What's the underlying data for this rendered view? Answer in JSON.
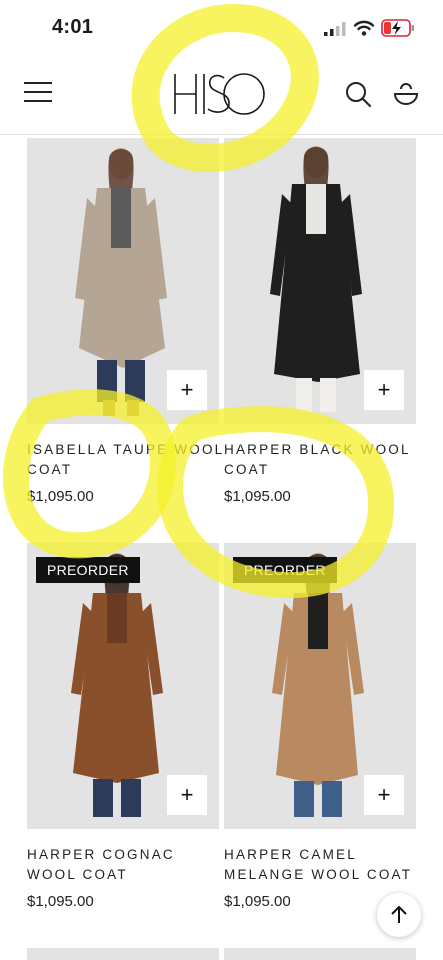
{
  "status_bar": {
    "time": "4:01"
  },
  "header": {
    "brand": "HiSO"
  },
  "products": [
    {
      "name": "ISABELLA TAUPE WOOL COAT",
      "price": "$1,095.00",
      "badge": "",
      "add_label": "+",
      "coat_color": "#b5a594"
    },
    {
      "name": "HARPER BLACK WOOL COAT",
      "price": "$1,095.00",
      "badge": "",
      "add_label": "+",
      "coat_color": "#1f1f1f"
    },
    {
      "name": "HARPER COGNAC WOOL COAT",
      "price": "$1,095.00",
      "badge": "PREORDER",
      "add_label": "+",
      "coat_color": "#8a4f2b"
    },
    {
      "name": "HARPER CAMEL MELANGE WOOL COAT",
      "price": "$1,095.00",
      "badge": "PREORDER",
      "add_label": "+",
      "coat_color": "#b98a62"
    }
  ],
  "colors": {
    "highlight": "#f4f02a",
    "photo_bg": "#e3e3e3",
    "badge_bg": "#111111"
  }
}
